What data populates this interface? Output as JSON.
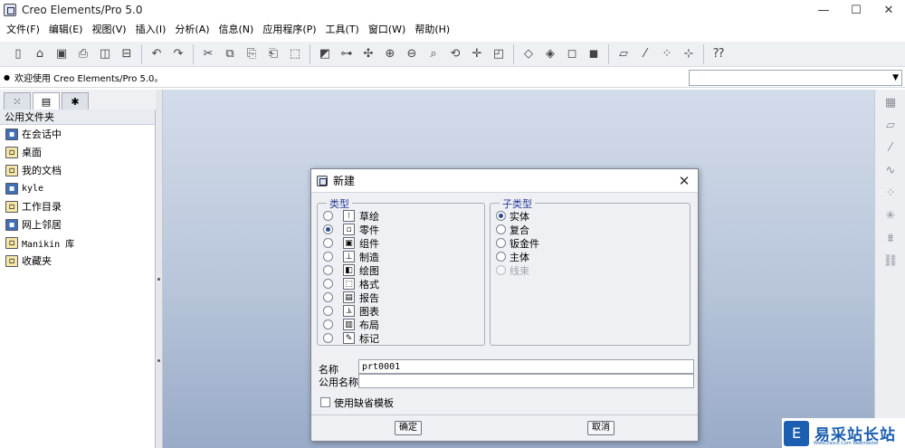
{
  "window": {
    "title": "Creo Elements/Pro 5.0",
    "controls": {
      "minimize": "—",
      "maximize": "☐",
      "close": "✕"
    }
  },
  "menubar": [
    {
      "label": "文件(F)"
    },
    {
      "label": "编辑(E)"
    },
    {
      "label": "视图(V)"
    },
    {
      "label": "插入(I)"
    },
    {
      "label": "分析(A)"
    },
    {
      "label": "信息(N)"
    },
    {
      "label": "应用程序(P)"
    },
    {
      "label": "工具(T)"
    },
    {
      "label": "窗口(W)"
    },
    {
      "label": "帮助(H)"
    }
  ],
  "toolbar": {
    "icons": [
      "new-file-icon",
      "open-file-icon",
      "save-icon",
      "print-icon",
      "copy-window-icon",
      "delete-icon",
      "undo-icon",
      "redo-icon",
      "cut-icon",
      "copy-icon",
      "paste-icon",
      "paste-special-icon",
      "select-box-icon",
      "regenerate-icon",
      "relations-icon",
      "layer-icon",
      "zoom-in-icon",
      "zoom-out-icon",
      "refit-icon",
      "reorient-icon",
      "spin-center-icon",
      "saved-views-icon",
      "view-box1-icon",
      "view-box2-icon",
      "view-box3-icon",
      "view-box4-icon",
      "datum-planes-icon",
      "datum-axes-icon",
      "datum-points-icon",
      "coord-sys-icon",
      "whats-this-icon"
    ]
  },
  "status": {
    "message": "欢迎使用 Creo Elements/Pro 5.0。",
    "combo_value": ""
  },
  "navigator": {
    "tabs": [
      "model-tree-icon",
      "folder-browser-icon",
      "favorites-icon"
    ],
    "header": "公用文件夹",
    "items": [
      {
        "label": "在会话中",
        "icon": "session-icon"
      },
      {
        "label": "桌面",
        "icon": "desktop-icon"
      },
      {
        "label": "我的文档",
        "icon": "documents-icon"
      },
      {
        "label": "kyle",
        "icon": "user-folder-icon"
      },
      {
        "label": "工作目录",
        "icon": "working-dir-icon"
      },
      {
        "label": "网上邻居",
        "icon": "network-icon"
      },
      {
        "label": "Manikin 库",
        "icon": "manikin-lib-icon"
      },
      {
        "label": "收藏夹",
        "icon": "favorites-folder-icon"
      }
    ]
  },
  "dialog": {
    "title": "新建",
    "type_group_label": "类型",
    "types": [
      {
        "label": "草绘",
        "selected": false
      },
      {
        "label": "零件",
        "selected": true
      },
      {
        "label": "组件",
        "selected": false
      },
      {
        "label": "制造",
        "selected": false
      },
      {
        "label": "绘图",
        "selected": false
      },
      {
        "label": "格式",
        "selected": false
      },
      {
        "label": "报告",
        "selected": false
      },
      {
        "label": "图表",
        "selected": false
      },
      {
        "label": "布局",
        "selected": false
      },
      {
        "label": "标记",
        "selected": false
      }
    ],
    "subtype_group_label": "子类型",
    "subtypes": [
      {
        "label": "实体",
        "selected": true,
        "disabled": false
      },
      {
        "label": "复合",
        "selected": false,
        "disabled": false
      },
      {
        "label": "钣金件",
        "selected": false,
        "disabled": false
      },
      {
        "label": "主体",
        "selected": false,
        "disabled": false
      },
      {
        "label": "线束",
        "selected": false,
        "disabled": true
      }
    ],
    "name_label": "名称",
    "name_value": "prt0001",
    "common_name_label": "公用名称",
    "common_name_value": "",
    "use_default_template_label": "使用缺省模板",
    "use_default_template_checked": false,
    "ok_label": "确定",
    "cancel_label": "取消"
  },
  "watermark": {
    "logo_char": "E",
    "text": "易采站长站",
    "subtext": "Www.Easck.Com Webmaster"
  },
  "colors": {
    "graphics_top": "#d3dcea",
    "graphics_bottom": "#99abc8",
    "accent": "#1c5fb0"
  }
}
